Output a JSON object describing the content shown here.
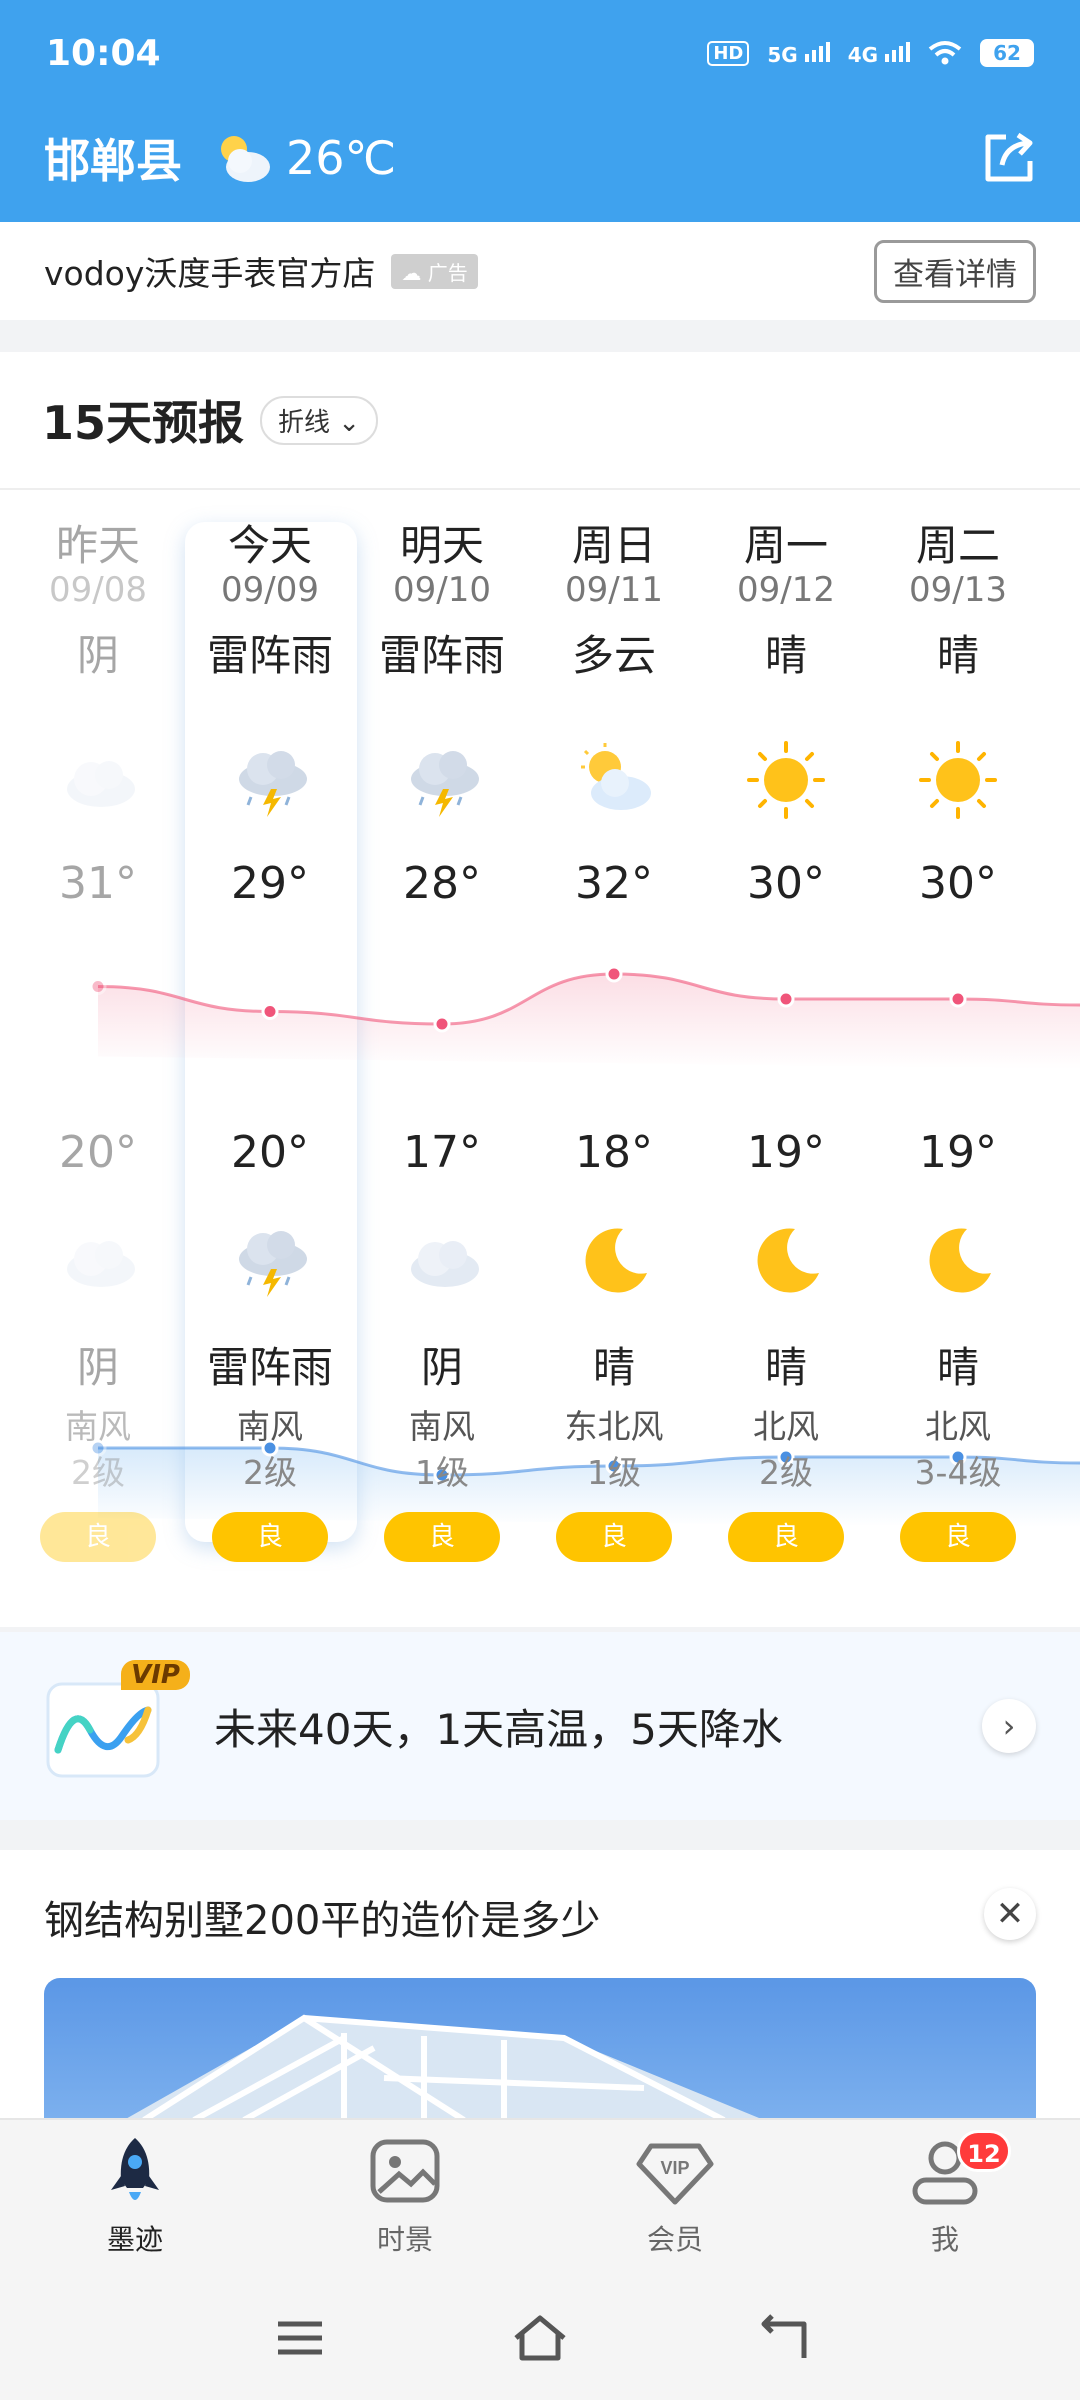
{
  "status_bar": {
    "time": "10:04",
    "hd_label": "HD",
    "net1": "5G",
    "net2": "4G",
    "battery": "62"
  },
  "header": {
    "city": "邯郸县",
    "temp": "26℃",
    "weather_icon": "partly-cloudy-icon",
    "share_icon": "share-icon"
  },
  "ad": {
    "title": "vodoy沃度手表官方店",
    "tag": "广告",
    "button": "查看详情"
  },
  "forecast": {
    "title": "15天预报",
    "mode": "折线",
    "days": [
      {
        "day": "昨天",
        "date": "09/08",
        "day_weather": "阴",
        "day_icon": "cloudy-icon",
        "high": "31°",
        "low": "20°",
        "night_icon": "cloudy-icon",
        "night_weather": "阴",
        "wind": "南风",
        "level": "2级",
        "aqi": "良"
      },
      {
        "day": "今天",
        "date": "09/09",
        "day_weather": "雷阵雨",
        "day_icon": "thunderstorm-icon",
        "high": "29°",
        "low": "20°",
        "night_icon": "thunderstorm-icon",
        "night_weather": "雷阵雨",
        "wind": "南风",
        "level": "2级",
        "aqi": "良"
      },
      {
        "day": "明天",
        "date": "09/10",
        "day_weather": "雷阵雨",
        "day_icon": "thunderstorm-icon",
        "high": "28°",
        "low": "17°",
        "night_icon": "cloudy-icon",
        "night_weather": "阴",
        "wind": "南风",
        "level": "1级",
        "aqi": "良"
      },
      {
        "day": "周日",
        "date": "09/11",
        "day_weather": "多云",
        "day_icon": "partly-cloudy-icon",
        "high": "32°",
        "low": "18°",
        "night_icon": "moon-icon",
        "night_weather": "晴",
        "wind": "东北风",
        "level": "1级",
        "aqi": "良"
      },
      {
        "day": "周一",
        "date": "09/12",
        "day_weather": "晴",
        "day_icon": "sun-icon",
        "high": "30°",
        "low": "19°",
        "night_icon": "moon-icon",
        "night_weather": "晴",
        "wind": "北风",
        "level": "2级",
        "aqi": "良"
      },
      {
        "day": "周二",
        "date": "09/13",
        "day_weather": "晴",
        "day_icon": "sun-icon",
        "high": "30°",
        "low": "19°",
        "night_icon": "moon-icon",
        "night_weather": "晴",
        "wind": "北风",
        "level": "3-4级",
        "aqi": "良"
      }
    ],
    "high_color": "#f0557a",
    "low_color": "#4a90e2",
    "aqi_color": "#ffc400"
  },
  "vip": {
    "badge": "VIP",
    "text": "未来40天，1天高温，5天降水"
  },
  "article": {
    "title": "钢结构别墅200平的造价是多少"
  },
  "bottom_nav": {
    "items": [
      {
        "label": "墨迹",
        "icon": "rocket-icon"
      },
      {
        "label": "时景",
        "icon": "image-icon"
      },
      {
        "label": "会员",
        "icon": "vip-diamond-icon"
      },
      {
        "label": "我",
        "icon": "person-icon"
      }
    ],
    "badge": "12"
  }
}
